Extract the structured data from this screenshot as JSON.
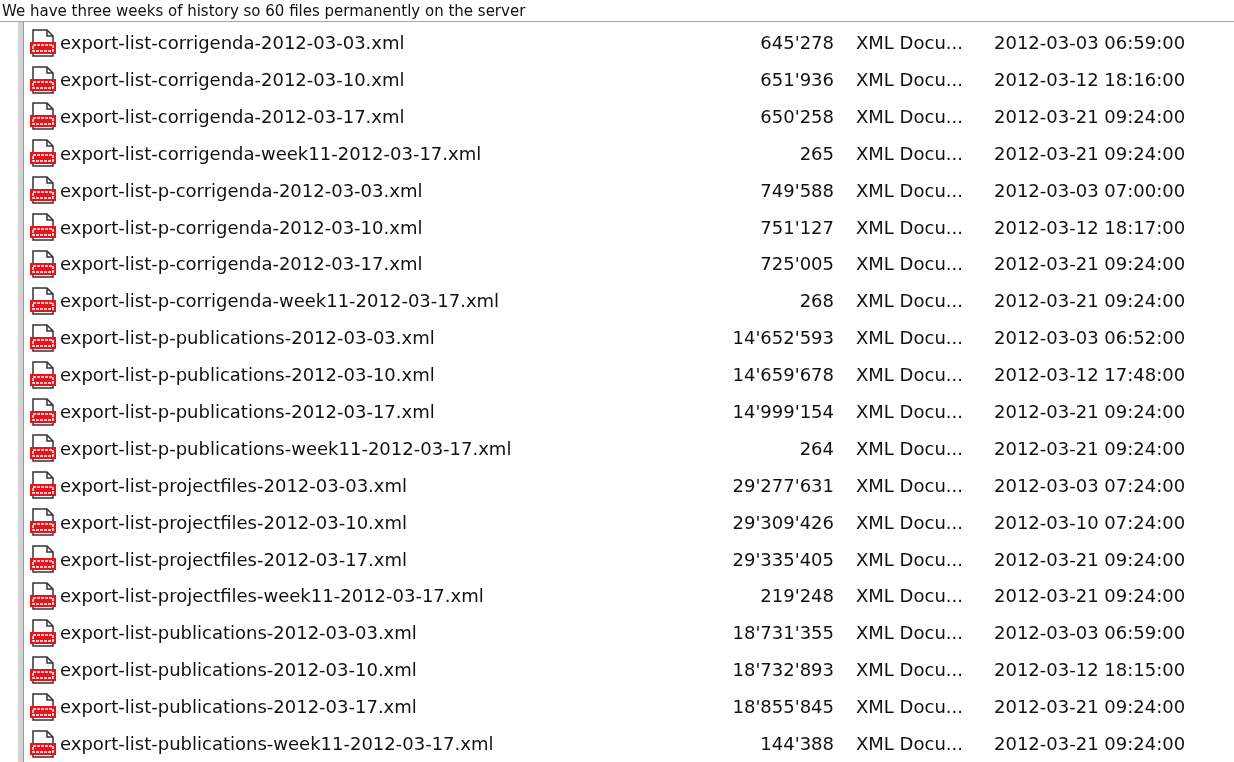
{
  "caption": "We have three weeks of history so 60 files permanently on the server",
  "files": [
    {
      "name": "export-list-corrigenda-2012-03-03.xml",
      "size": "645'278",
      "type": "XML Docu...",
      "modified": "2012-03-03 06:59:00"
    },
    {
      "name": "export-list-corrigenda-2012-03-10.xml",
      "size": "651'936",
      "type": "XML Docu...",
      "modified": "2012-03-12 18:16:00"
    },
    {
      "name": "export-list-corrigenda-2012-03-17.xml",
      "size": "650'258",
      "type": "XML Docu...",
      "modified": "2012-03-21 09:24:00"
    },
    {
      "name": "export-list-corrigenda-week11-2012-03-17.xml",
      "size": "265",
      "type": "XML Docu...",
      "modified": "2012-03-21 09:24:00"
    },
    {
      "name": "export-list-p-corrigenda-2012-03-03.xml",
      "size": "749'588",
      "type": "XML Docu...",
      "modified": "2012-03-03 07:00:00"
    },
    {
      "name": "export-list-p-corrigenda-2012-03-10.xml",
      "size": "751'127",
      "type": "XML Docu...",
      "modified": "2012-03-12 18:17:00"
    },
    {
      "name": "export-list-p-corrigenda-2012-03-17.xml",
      "size": "725'005",
      "type": "XML Docu...",
      "modified": "2012-03-21 09:24:00"
    },
    {
      "name": "export-list-p-corrigenda-week11-2012-03-17.xml",
      "size": "268",
      "type": "XML Docu...",
      "modified": "2012-03-21 09:24:00"
    },
    {
      "name": "export-list-p-publications-2012-03-03.xml",
      "size": "14'652'593",
      "type": "XML Docu...",
      "modified": "2012-03-03 06:52:00"
    },
    {
      "name": "export-list-p-publications-2012-03-10.xml",
      "size": "14'659'678",
      "type": "XML Docu...",
      "modified": "2012-03-12 17:48:00"
    },
    {
      "name": "export-list-p-publications-2012-03-17.xml",
      "size": "14'999'154",
      "type": "XML Docu...",
      "modified": "2012-03-21 09:24:00"
    },
    {
      "name": "export-list-p-publications-week11-2012-03-17.xml",
      "size": "264",
      "type": "XML Docu...",
      "modified": "2012-03-21 09:24:00"
    },
    {
      "name": "export-list-projectfiles-2012-03-03.xml",
      "size": "29'277'631",
      "type": "XML Docu...",
      "modified": "2012-03-03 07:24:00"
    },
    {
      "name": "export-list-projectfiles-2012-03-10.xml",
      "size": "29'309'426",
      "type": "XML Docu...",
      "modified": "2012-03-10 07:24:00"
    },
    {
      "name": "export-list-projectfiles-2012-03-17.xml",
      "size": "29'335'405",
      "type": "XML Docu...",
      "modified": "2012-03-21 09:24:00"
    },
    {
      "name": "export-list-projectfiles-week11-2012-03-17.xml",
      "size": "219'248",
      "type": "XML Docu...",
      "modified": "2012-03-21 09:24:00"
    },
    {
      "name": "export-list-publications-2012-03-03.xml",
      "size": "18'731'355",
      "type": "XML Docu...",
      "modified": "2012-03-03 06:59:00"
    },
    {
      "name": "export-list-publications-2012-03-10.xml",
      "size": "18'732'893",
      "type": "XML Docu...",
      "modified": "2012-03-12 18:15:00"
    },
    {
      "name": "export-list-publications-2012-03-17.xml",
      "size": "18'855'845",
      "type": "XML Docu...",
      "modified": "2012-03-21 09:24:00"
    },
    {
      "name": "export-list-publications-week11-2012-03-17.xml",
      "size": "144'388",
      "type": "XML Docu...",
      "modified": "2012-03-21 09:24:00"
    }
  ]
}
